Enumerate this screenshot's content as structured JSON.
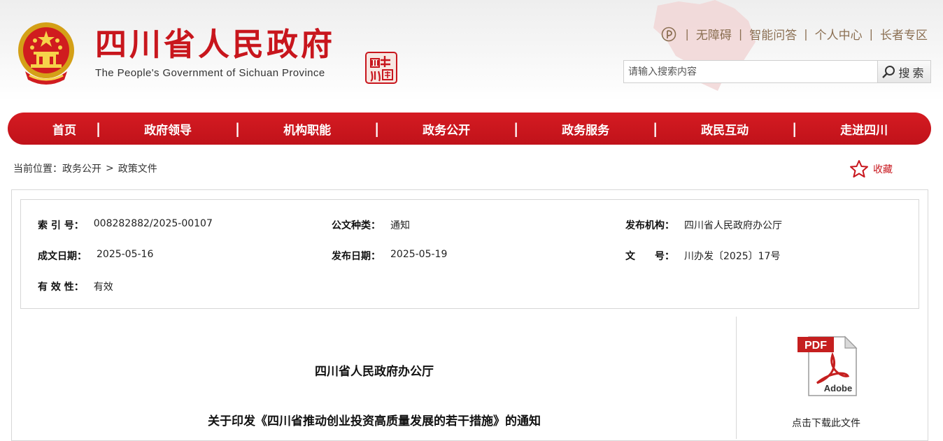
{
  "header": {
    "title": "四川省人民政府",
    "subtitle": "The People's Government of Sichuan Province",
    "seal_text": "中国四川",
    "links": [
      "无障碍",
      "智能问答",
      "个人中心",
      "长者专区"
    ],
    "separator": "|"
  },
  "search": {
    "placeholder": "请输入搜索内容",
    "button_label": "搜索"
  },
  "nav": {
    "items": [
      "首页",
      "政府领导",
      "机构职能",
      "政务公开",
      "政务服务",
      "政民互动",
      "走进四川"
    ],
    "separator": "|"
  },
  "breadcrumb": {
    "prefix": "当前位置：",
    "items": [
      "政务公开",
      "政策文件"
    ],
    "separator": ">"
  },
  "favorite": {
    "label": "收藏"
  },
  "meta": {
    "index_label": "索 引 号：",
    "index_value": "008282882/2025-00107",
    "category_label": "公文种类：",
    "category_value": "通知",
    "issuer_label": "发布机构：",
    "issuer_value": "四川省人民政府办公厅",
    "written_label": "成文日期：",
    "written_value": "2025-05-16",
    "published_label": "发布日期：",
    "published_value": "2025-05-19",
    "docno_label": "文　　号：",
    "docno_value": "川办发〔2025〕17号",
    "validity_label": "有 效 性：",
    "validity_value": "有效"
  },
  "document": {
    "issuer": "四川省人民政府办公厅",
    "title": "关于印发《四川省推动创业投资高质量发展的若干措施》的通知"
  },
  "download": {
    "icon_label": "PDF",
    "brand": "Adobe",
    "label": "点击下载此文件"
  },
  "colors": {
    "brand_red": "#c8161d",
    "link_brown": "#8b6f52"
  }
}
